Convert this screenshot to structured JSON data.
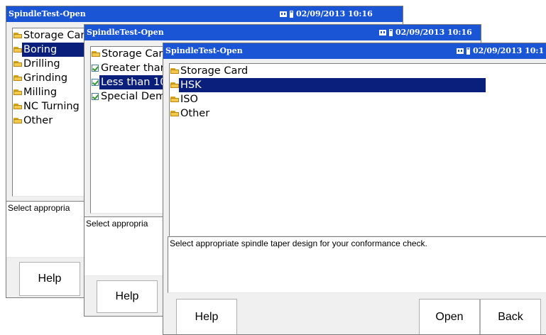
{
  "window1": {
    "title": "SpindleTest-Open",
    "datetime": "02/09/2013 10:16",
    "items": [
      {
        "label": "Storage Card",
        "icon": "folder-icon"
      },
      {
        "label": "Boring",
        "icon": "folder-icon",
        "selected": true
      },
      {
        "label": "Drilling",
        "icon": "folder-icon"
      },
      {
        "label": "Grinding",
        "icon": "folder-icon"
      },
      {
        "label": "Milling",
        "icon": "folder-icon"
      },
      {
        "label": "NC Turning",
        "icon": "folder-icon"
      },
      {
        "label": "Other",
        "icon": "folder-icon"
      }
    ],
    "description": "Select appropria",
    "help_label": "Help"
  },
  "window2": {
    "title": "SpindleTest-Open",
    "datetime": "02/09/2013 10:16",
    "items": [
      {
        "label": "Storage Car",
        "icon": "folder-icon"
      },
      {
        "label": "Greater thar",
        "icon": "check-icon"
      },
      {
        "label": "Less than 10",
        "icon": "check-icon",
        "selected": true
      },
      {
        "label": "Special Dem",
        "icon": "check-icon"
      }
    ],
    "description": "Select appropria",
    "help_label": "Help"
  },
  "window3": {
    "title": "SpindleTest-Open",
    "datetime": "02/09/2013 10:1",
    "items": [
      {
        "label": "Storage Card",
        "icon": "folder-icon"
      },
      {
        "label": "HSK",
        "icon": "folder-icon",
        "selected": true
      },
      {
        "label": "ISO",
        "icon": "folder-icon"
      },
      {
        "label": "Other",
        "icon": "folder-icon"
      }
    ],
    "description": "Select appropriate spindle taper design for your conformance check.",
    "help_label": "Help",
    "open_label": "Open",
    "back_label": "Back"
  },
  "colors": {
    "titlebar": "#1a55d6",
    "selection": "#0a1f7c",
    "window_bg": "#f0f0f0"
  }
}
